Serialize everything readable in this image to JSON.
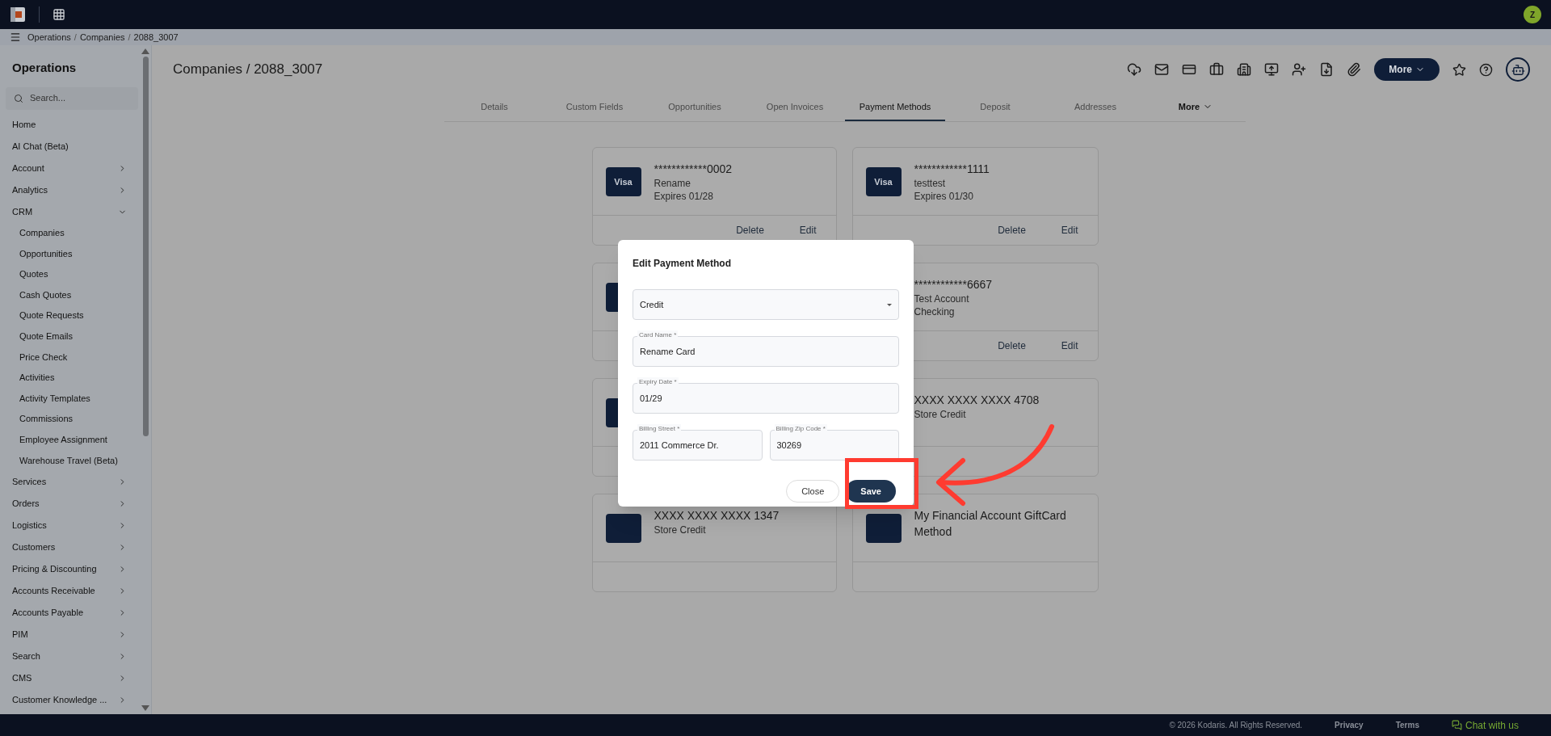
{
  "top_bar": {
    "avatar": "Z"
  },
  "breadcrumb": [
    {
      "label": "Operations",
      "kind": "link"
    },
    {
      "label": "/",
      "kind": "separator"
    },
    {
      "label": "Companies",
      "kind": "link"
    },
    {
      "label": "/",
      "kind": "separator"
    },
    {
      "label": "2088_3007",
      "kind": "link"
    }
  ],
  "sidebar": {
    "title": "Operations",
    "search_placeholder": "Search...",
    "items": [
      {
        "label": "Home",
        "kind": "link"
      },
      {
        "label": "AI Chat (Beta)",
        "kind": "link"
      },
      {
        "label": "Account",
        "kind": "group",
        "expanded": false
      },
      {
        "label": "Analytics",
        "kind": "group",
        "expanded": false
      },
      {
        "label": "CRM",
        "kind": "group",
        "expanded": true,
        "children": [
          "Companies",
          "Opportunities",
          "Quotes",
          "Cash Quotes",
          "Quote Requests",
          "Quote Emails",
          "Price Check",
          "Activities",
          "Activity Templates",
          "Commissions",
          "Employee Assignment",
          "Warehouse Travel (Beta)"
        ]
      },
      {
        "label": "Services",
        "kind": "group",
        "expanded": false
      },
      {
        "label": "Orders",
        "kind": "group",
        "expanded": false
      },
      {
        "label": "Logistics",
        "kind": "group",
        "expanded": false
      },
      {
        "label": "Customers",
        "kind": "group",
        "expanded": false
      },
      {
        "label": "Pricing & Discounting",
        "kind": "group",
        "expanded": false
      },
      {
        "label": "Accounts Receivable",
        "kind": "group",
        "expanded": false
      },
      {
        "label": "Accounts Payable",
        "kind": "group",
        "expanded": false
      },
      {
        "label": "PIM",
        "kind": "group",
        "expanded": false
      },
      {
        "label": "Search",
        "kind": "group",
        "expanded": false
      },
      {
        "label": "CMS",
        "kind": "group",
        "expanded": false
      },
      {
        "label": "Customer Knowledge ...",
        "kind": "group",
        "expanded": false
      }
    ]
  },
  "page": {
    "title": "Companies / 2088_3007",
    "more_button": "More"
  },
  "tabs": [
    {
      "label": "Details",
      "selected": false
    },
    {
      "label": "Custom Fields",
      "selected": false
    },
    {
      "label": "Opportunities",
      "selected": false
    },
    {
      "label": "Open Invoices",
      "selected": false
    },
    {
      "label": "Payment Methods",
      "selected": true
    },
    {
      "label": "Deposit",
      "selected": false
    },
    {
      "label": "Addresses",
      "selected": false
    },
    {
      "label": "More",
      "selected": false,
      "kind": "menu"
    }
  ],
  "cards": [
    {
      "kind": "card",
      "brand": "Visa",
      "number": "************0002",
      "lines": [
        "Rename",
        "Expires 01/28"
      ],
      "actions": [
        "Delete",
        "Edit"
      ]
    },
    {
      "kind": "card",
      "brand": "Visa",
      "number": "************1111",
      "lines": [
        "testtest",
        "Expires 01/30"
      ],
      "actions": [
        "Delete",
        "Edit"
      ]
    },
    {
      "kind": "covered",
      "tile": true
    },
    {
      "kind": "card",
      "number": "************6667",
      "lines": [
        "Test Account",
        "Checking"
      ],
      "actions": [
        "Delete",
        "Edit"
      ]
    },
    {
      "kind": "covered",
      "tile": true
    },
    {
      "kind": "card",
      "number": "XXXX XXXX XXXX 4708",
      "lines": [
        "Store Credit"
      ]
    },
    {
      "kind": "card",
      "tile": true,
      "number": "XXXX XXXX XXXX 1347",
      "lines": [
        "Store Credit"
      ]
    },
    {
      "kind": "card",
      "tile": true,
      "number": "My Financial Account GiftCard Method"
    }
  ],
  "modal": {
    "title": "Edit Payment Method",
    "type_select": "Credit",
    "fields": [
      {
        "label": "Card Name *",
        "value": "Rename Card"
      },
      {
        "label": "Expiry Date *",
        "value": "01/29"
      },
      {
        "label": "Billing Street *",
        "value": "2011 Commerce Dr."
      },
      {
        "label": "Billing Zip Code *",
        "value": "30269"
      }
    ],
    "buttons": [
      "Close",
      "Save"
    ]
  },
  "footer": {
    "copyright": "© 2026 Kodaris. All Rights Reserved.",
    "links": [
      "Privacy",
      "Terms"
    ],
    "chat": "Chat with us"
  }
}
